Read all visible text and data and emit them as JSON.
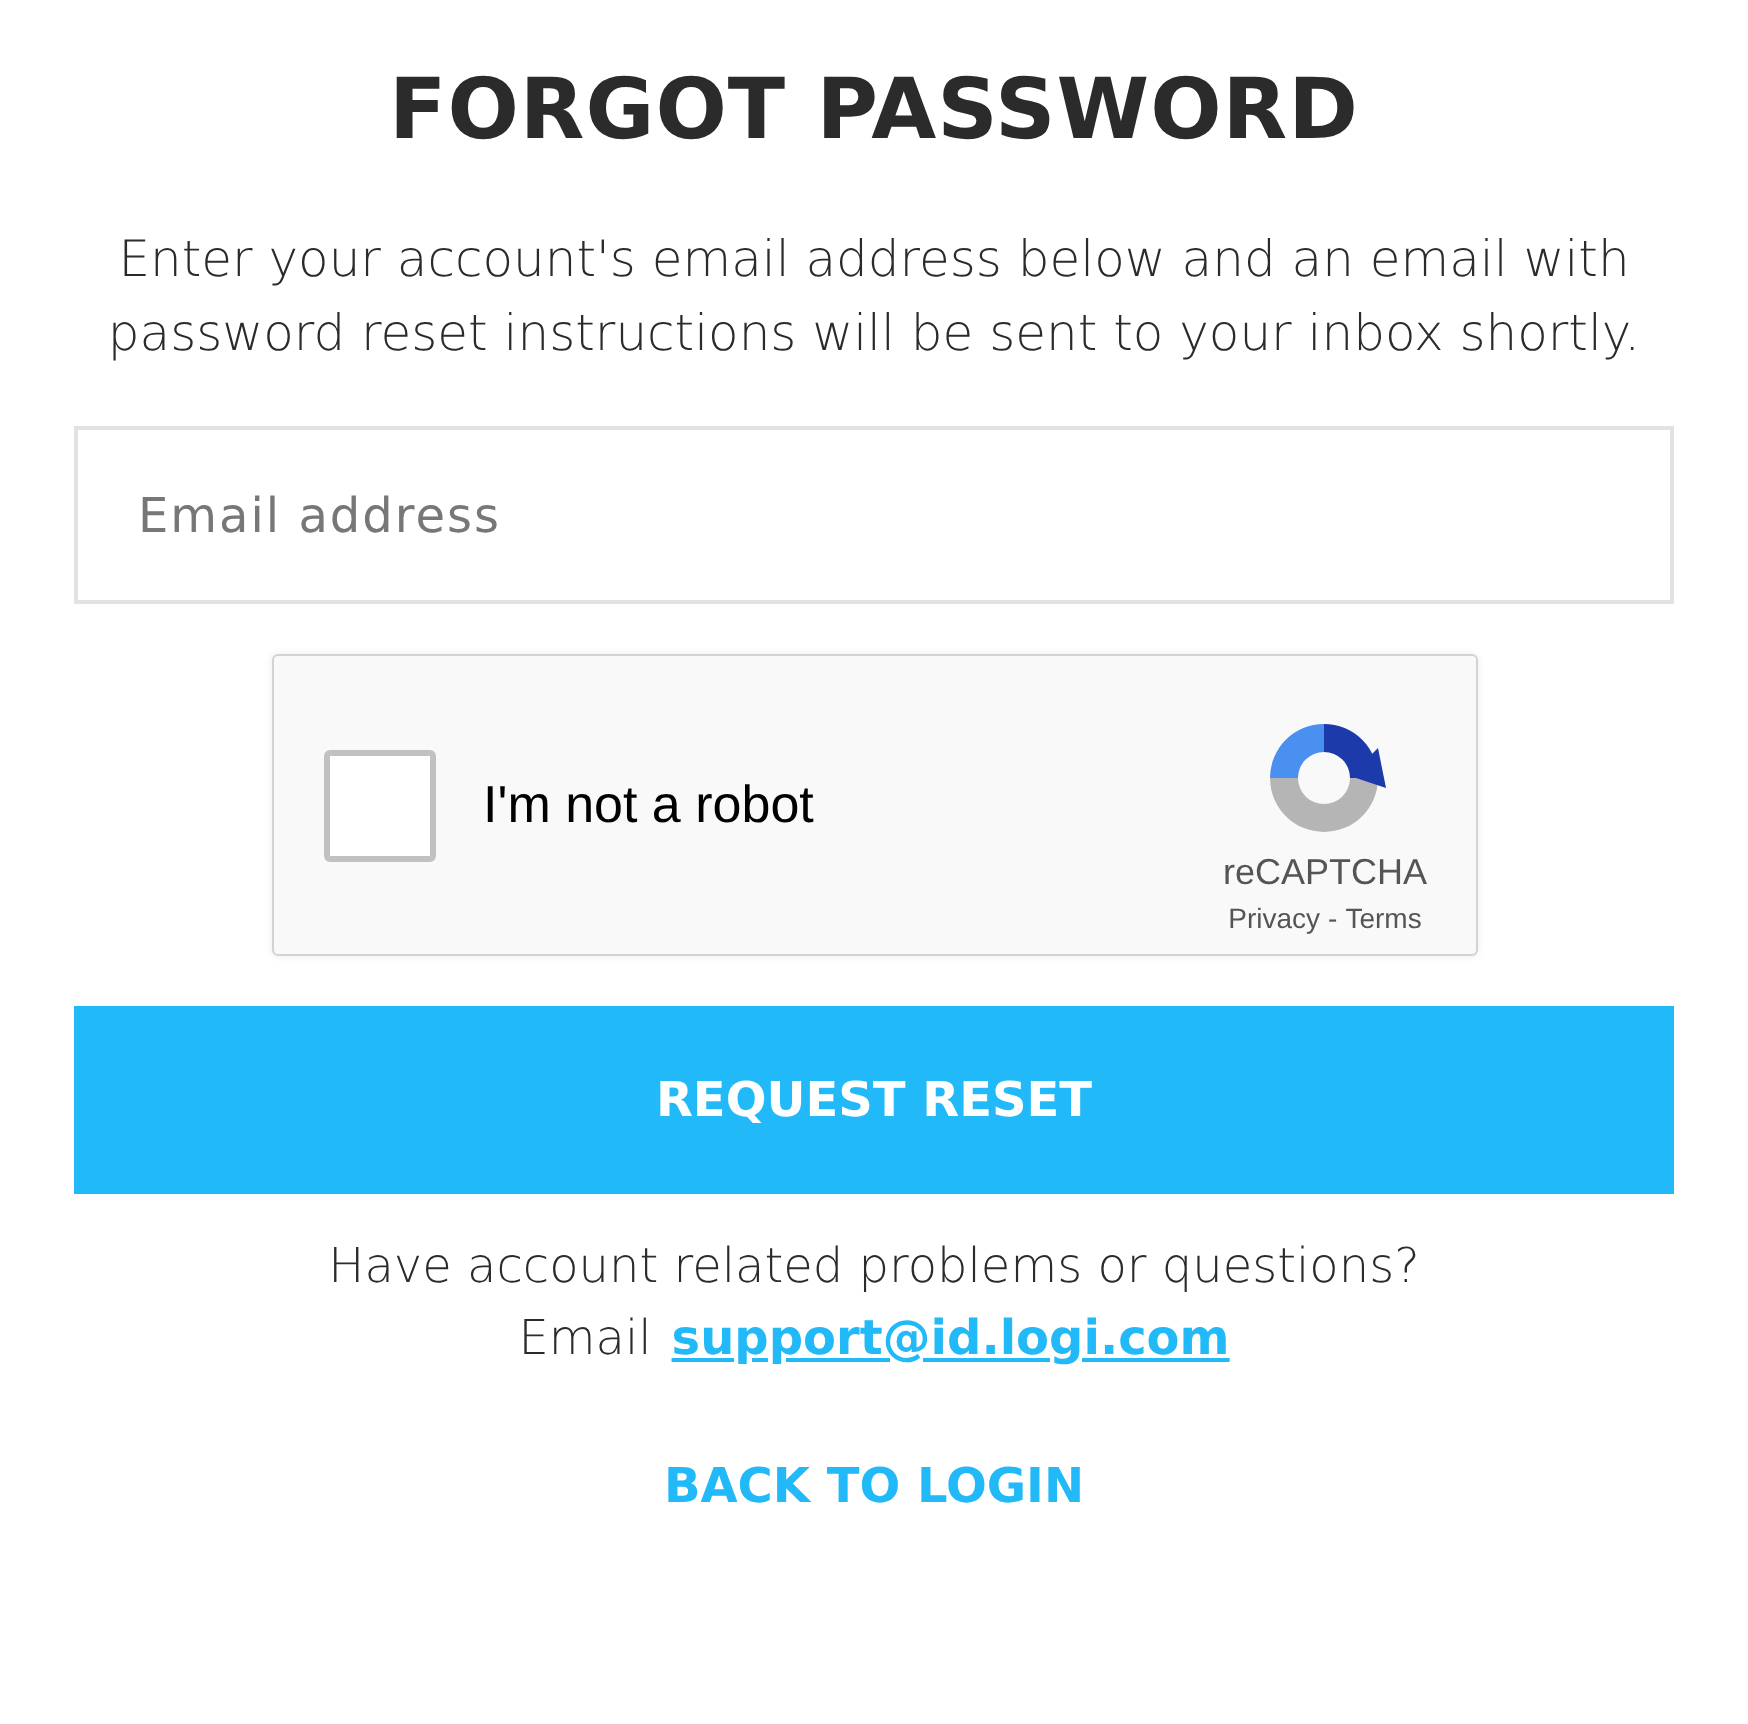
{
  "title": "FORGOT PASSWORD",
  "description": "Enter your account's email address below and an email with password reset instructions will be sent to your inbox shortly.",
  "email_field": {
    "placeholder": "Email address"
  },
  "captcha": {
    "checked": false,
    "label": "I'm not a robot",
    "brand": "reCAPTCHA",
    "privacy": "Privacy",
    "separator": "-",
    "terms": "Terms"
  },
  "submit_button": "REQUEST RESET",
  "help": {
    "question": "Have account related problems or questions?",
    "prefix": "Email",
    "link": "support@id.logi.com"
  },
  "back_link": "BACK TO LOGIN"
}
